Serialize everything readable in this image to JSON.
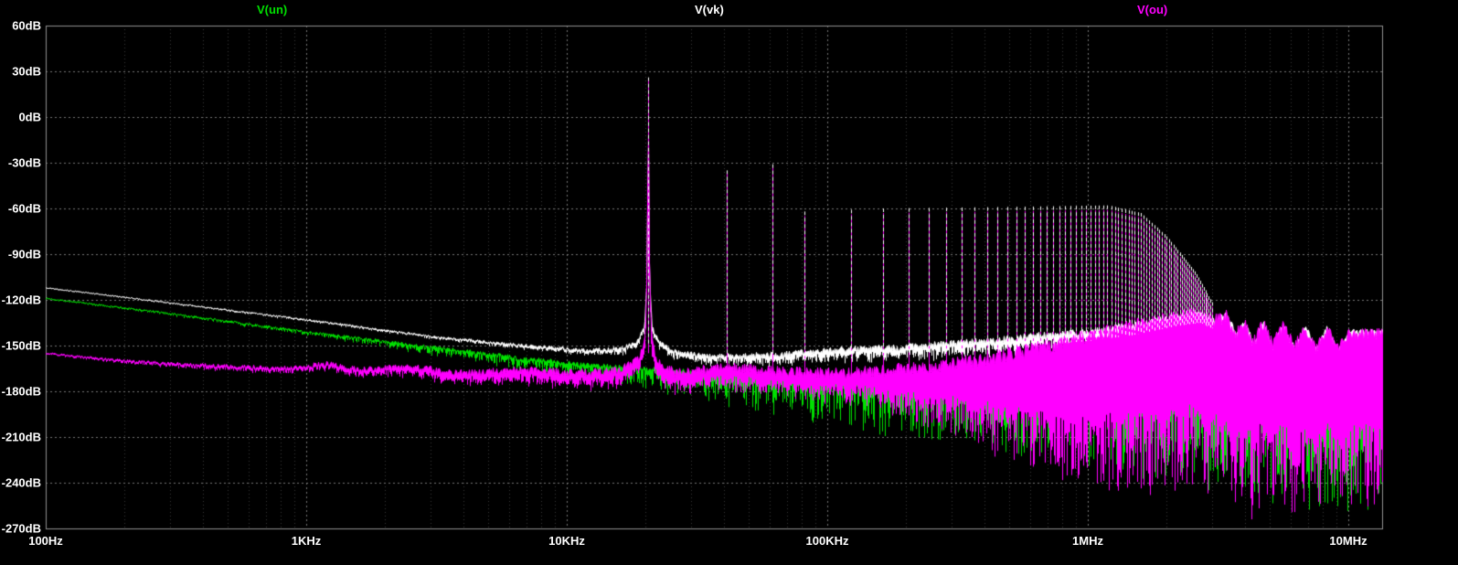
{
  "window": {
    "background": "#000000"
  },
  "chart_data": {
    "type": "line",
    "title": "",
    "x_axis": {
      "scale": "log",
      "unit": "Hz",
      "min_hz": 100,
      "max_hz": 10000000,
      "tick_hz": [
        100,
        1000,
        10000,
        100000,
        1000000,
        10000000
      ],
      "tick_labels": [
        "100Hz",
        "1KHz",
        "10KHz",
        "100KHz",
        "1MHz",
        "10MHz"
      ]
    },
    "y_axis": {
      "unit": "dB",
      "min": -270,
      "max": 60,
      "step": 30,
      "tick_labels": [
        "60dB",
        "30dB",
        "0dB",
        "-30dB",
        "-60dB",
        "-90dB",
        "-120dB",
        "-150dB",
        "-180dB",
        "-210dB",
        "-240dB",
        "-270dB"
      ]
    },
    "grid": {
      "background": "#000000",
      "minor_color": "#3a3a3a",
      "major_color": "#787878",
      "border_color": "#909090",
      "text_color": "#ffffff"
    },
    "series": [
      {
        "name": "V(un)",
        "color": "#00e000",
        "seed": 7,
        "solidity": 0.15,
        "top": [
          [
            100,
            -119
          ],
          [
            300,
            -129
          ],
          [
            1000,
            -141
          ],
          [
            3000,
            -151
          ],
          [
            7000,
            -159
          ],
          [
            15000,
            -164
          ],
          [
            40000,
            -169
          ],
          [
            100000,
            -173
          ],
          [
            300000,
            -178
          ],
          [
            1000000,
            -183
          ],
          [
            3000000,
            -189
          ],
          [
            10000000,
            -197
          ]
        ],
        "jitter": [
          [
            100,
            1
          ],
          [
            1000,
            1.5
          ],
          [
            5000,
            3
          ],
          [
            20000,
            4
          ],
          [
            100000,
            5
          ],
          [
            1000000,
            7
          ],
          [
            10000000,
            9
          ]
        ],
        "down": [
          [
            100,
            0.5
          ],
          [
            1000,
            2
          ],
          [
            5000,
            6
          ],
          [
            20000,
            12
          ],
          [
            100000,
            28
          ],
          [
            500000,
            40
          ],
          [
            2000000,
            52
          ],
          [
            10000000,
            68
          ]
        ],
        "spikes": []
      },
      {
        "name": "V(vk)",
        "color": "#ffffff",
        "seed": 13,
        "solidity": 0.4,
        "dash_overlay": true,
        "top": [
          [
            100,
            -112
          ],
          [
            300,
            -122
          ],
          [
            1000,
            -133
          ],
          [
            3000,
            -144
          ],
          [
            7000,
            -150
          ],
          [
            12000,
            -153
          ],
          [
            16000,
            -152
          ],
          [
            18500,
            -148
          ],
          [
            19800,
            -138
          ],
          [
            20250,
            -108
          ],
          [
            20400,
            -45
          ],
          [
            20480,
            20
          ],
          [
            20560,
            -45
          ],
          [
            20720,
            -108
          ],
          [
            21200,
            -138
          ],
          [
            22500,
            -148
          ],
          [
            26000,
            -154
          ],
          [
            35000,
            -157
          ],
          [
            60000,
            -156
          ],
          [
            100000,
            -153
          ],
          [
            200000,
            -151
          ],
          [
            400000,
            -147
          ],
          [
            700000,
            -143
          ],
          [
            1000000,
            -141
          ],
          [
            1500000,
            -137
          ],
          [
            2200000,
            -131
          ],
          [
            2700000,
            -129
          ],
          [
            3100000,
            -134
          ],
          [
            3400000,
            -129
          ],
          [
            3700000,
            -143
          ],
          [
            4000000,
            -134
          ],
          [
            4300000,
            -149
          ],
          [
            4700000,
            -135
          ],
          [
            5100000,
            -151
          ],
          [
            5600000,
            -136
          ],
          [
            6200000,
            -152
          ],
          [
            6800000,
            -137
          ],
          [
            7500000,
            -153
          ],
          [
            8300000,
            -138
          ],
          [
            9100000,
            -154
          ],
          [
            10000000,
            -141
          ]
        ],
        "jitter": [
          [
            100,
            0.6
          ],
          [
            2000,
            1.2
          ],
          [
            8000,
            2
          ],
          [
            30000,
            3
          ],
          [
            100000,
            4
          ],
          [
            1000000,
            5
          ],
          [
            4000000,
            4
          ],
          [
            10000000,
            4
          ]
        ],
        "down": [
          [
            100,
            0.3
          ],
          [
            3000,
            1.5
          ],
          [
            10000,
            3
          ],
          [
            25000,
            5
          ],
          [
            60000,
            7
          ],
          [
            200000,
            9
          ],
          [
            1000000,
            11
          ],
          [
            3000000,
            12
          ],
          [
            10000000,
            14
          ]
        ],
        "spikes": [
          [
            20480,
            26,
            -150
          ],
          [
            40960,
            -35,
            -157
          ],
          [
            61440,
            -31,
            -156
          ]
        ],
        "comb": {
          "spacing_hz": 40960,
          "k_start": 2,
          "k_end": 73,
          "max_hz": 3000000,
          "dash": true,
          "tops": [
            [
              81920,
              -62
            ],
            [
              163840,
              -60
            ],
            [
              500000,
              -59
            ],
            [
              1200000,
              -58
            ],
            [
              1600000,
              -63
            ],
            [
              2000000,
              -78
            ],
            [
              2600000,
              -102
            ],
            [
              3000000,
              -122
            ]
          ]
        }
      },
      {
        "name": "V(ou)",
        "color": "#ff00ff",
        "seed": 29,
        "solidity": 0.55,
        "top": [
          [
            100,
            -155
          ],
          [
            200,
            -160
          ],
          [
            400,
            -163
          ],
          [
            800,
            -165
          ],
          [
            1200,
            -162
          ],
          [
            1600,
            -166
          ],
          [
            2500,
            -164
          ],
          [
            4000,
            -168
          ],
          [
            7000,
            -166
          ],
          [
            12000,
            -168
          ],
          [
            16000,
            -166
          ],
          [
            19000,
            -158
          ],
          [
            19900,
            -145
          ],
          [
            20250,
            -105
          ],
          [
            20400,
            -40
          ],
          [
            20480,
            25
          ],
          [
            20560,
            -40
          ],
          [
            20720,
            -105
          ],
          [
            21100,
            -145
          ],
          [
            22000,
            -160
          ],
          [
            26000,
            -168
          ],
          [
            40000,
            -164
          ],
          [
            70000,
            -167
          ],
          [
            120000,
            -168
          ],
          [
            250000,
            -164
          ],
          [
            400000,
            -159
          ],
          [
            600000,
            -153
          ],
          [
            800000,
            -148
          ],
          [
            1000000,
            -144
          ],
          [
            1300000,
            -139
          ],
          [
            1700000,
            -135
          ],
          [
            2100000,
            -132
          ],
          [
            2600000,
            -128
          ],
          [
            3000000,
            -133
          ],
          [
            3400000,
            -131
          ],
          [
            3700000,
            -143
          ],
          [
            4000000,
            -134
          ],
          [
            4300000,
            -148
          ],
          [
            4700000,
            -136
          ],
          [
            5100000,
            -150
          ],
          [
            5600000,
            -137
          ],
          [
            6200000,
            -151
          ],
          [
            6800000,
            -138
          ],
          [
            7500000,
            -152
          ],
          [
            8300000,
            -139
          ],
          [
            9100000,
            -153
          ],
          [
            10000000,
            -142
          ]
        ],
        "jitter": [
          [
            100,
            1
          ],
          [
            600,
            3
          ],
          [
            2000,
            4
          ],
          [
            10000,
            5
          ],
          [
            50000,
            6
          ],
          [
            200000,
            8
          ],
          [
            1000000,
            10
          ],
          [
            10000000,
            8
          ]
        ],
        "down": [
          [
            100,
            1
          ],
          [
            1000,
            3
          ],
          [
            5000,
            8
          ],
          [
            20000,
            12
          ],
          [
            60000,
            15
          ],
          [
            150000,
            22
          ],
          [
            300000,
            45
          ],
          [
            600000,
            75
          ],
          [
            1000000,
            100
          ],
          [
            2000000,
            115
          ],
          [
            4000000,
            115
          ],
          [
            7000000,
            115
          ],
          [
            10000000,
            112
          ]
        ],
        "spikes": [
          [
            20480,
            25,
            -155
          ],
          [
            40960,
            -36,
            -165
          ],
          [
            61440,
            -32,
            -166
          ]
        ],
        "comb": {
          "spacing_hz": 40960,
          "k_start": 2,
          "k_end": 73,
          "max_hz": 3000000,
          "dash": false,
          "tops": [
            [
              81920,
              -65
            ],
            [
              163840,
              -63
            ],
            [
              500000,
              -62
            ],
            [
              1200000,
              -61
            ],
            [
              1600000,
              -66
            ],
            [
              2000000,
              -81
            ],
            [
              2600000,
              -105
            ],
            [
              3000000,
              -125
            ]
          ]
        }
      }
    ]
  }
}
